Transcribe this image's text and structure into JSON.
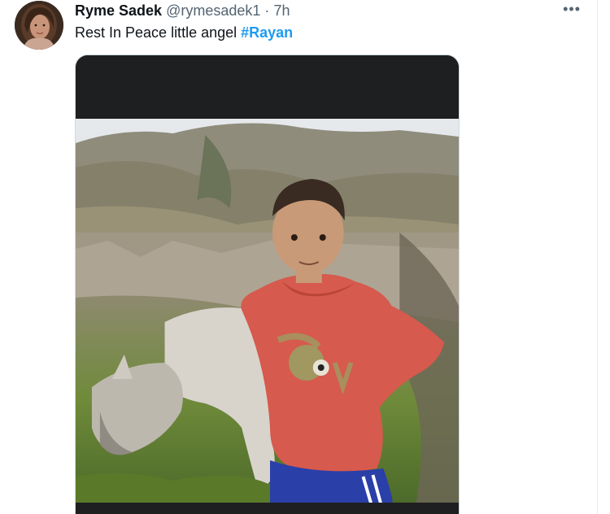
{
  "tweet": {
    "display_name": "Ryme Sadek",
    "handle": "@rymesadek1",
    "separator": "·",
    "time": "7h",
    "more_icon": "more-horizontal-icon",
    "more_label": "•••",
    "text_plain": "Rest In Peace little angel ",
    "hashtag": "#Rayan"
  },
  "colors": {
    "accent": "#1d9bf0",
    "secondary_text": "#536471",
    "primary_text": "#0f1419"
  }
}
